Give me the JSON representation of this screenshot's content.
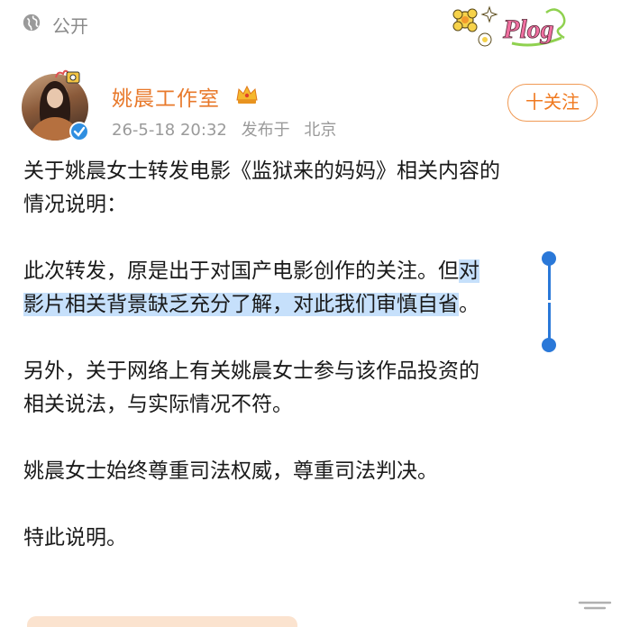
{
  "header": {
    "visibility_label": "公开",
    "sticker_text": "Plog"
  },
  "account": {
    "name": "姚晨工作室",
    "date": "26-5-18 20:32",
    "published_at": "发布于",
    "location": "北京"
  },
  "follow_button": {
    "label": "十关注"
  },
  "post": {
    "p1_l1": "关于姚晨女士转发电影《监狱来的妈妈》相关内容的",
    "p1_l2": "情况说明：",
    "p2_l1_a": "此次转发，原是出于对国产电影创作的关注。但",
    "p2_l1_b": "对",
    "p2_l2": "影片相关背景缺乏充分了解，对此我们审慎自省",
    "p2_l2_end": "。",
    "p3_l1": "另外，关于网络上有关姚晨女士参与该作品投资的",
    "p3_l2": "相关说法，与实际情况不符。",
    "p4": "姚晨女士始终尊重司法权威，尊重司法判决。",
    "p5": "特此说明。"
  },
  "colors": {
    "accent": "#e8792b",
    "selection": "#c6e0fb",
    "selection_handle": "#2a78d8",
    "meta": "#9a9a9a"
  },
  "icons": [
    "globe-icon",
    "plog-sticker",
    "crown-icon",
    "verified-icon",
    "drag-handle-icon"
  ]
}
